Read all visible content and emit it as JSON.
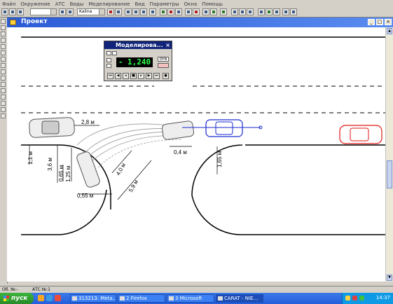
{
  "menu": [
    "Файл",
    "Окружение",
    "АТС",
    "Виды",
    "Моделирование",
    "Вид",
    "Параметры",
    "Окна",
    "Помощь"
  ],
  "toolbar": {
    "vehicle_combo": "Kalina"
  },
  "window": {
    "title": "Проект"
  },
  "simulator": {
    "title": "Моделирова...",
    "time_value": "- 1,240",
    "dyn_label": "DYN",
    "close": "×"
  },
  "drawing": {
    "dim_labels": [
      "2,8 м",
      "1,1 м",
      "3,6 м",
      "0,65 м",
      "1,25 м",
      "4,0 м",
      "5,9 м",
      "0,55 м",
      "0,4 м",
      "1,65 м"
    ]
  },
  "status": {
    "left": "Об. №:-",
    "right": "АТС №:1"
  },
  "taskbar": {
    "start": "пуск",
    "tasks": [
      "313213: Meta...",
      "2 Firefox",
      "3 Microsoft",
      "CARAT - NIE..."
    ],
    "clock": "14:37"
  }
}
